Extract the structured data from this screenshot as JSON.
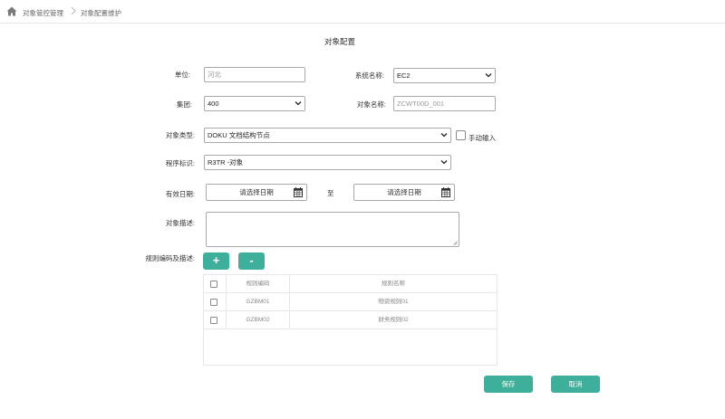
{
  "breadcrumb": {
    "home_icon": "home-icon",
    "item1": "对象管控管理",
    "item2": "对象配置维护"
  },
  "page": {
    "title": "对象配置"
  },
  "form": {
    "unit": {
      "label": "单位:",
      "value": "",
      "placeholder": "河北"
    },
    "system_name": {
      "label": "系统名称:",
      "value": "EC2"
    },
    "group": {
      "label": "集团:",
      "value": "400"
    },
    "object_name": {
      "label": "对象名称:",
      "value": "",
      "placeholder": "ZCWT00D_001"
    },
    "object_type": {
      "label": "对象类型:",
      "value": "DOKU 文档结构节点"
    },
    "manual_input": {
      "label": "手动输入",
      "checked": false
    },
    "program_id": {
      "label": "程序标识:",
      "value": "R3TR -对象"
    },
    "valid_date": {
      "label": "有效日期:",
      "start_placeholder": "请选择日期",
      "to_label": "至",
      "end_placeholder": "请选择日期"
    },
    "object_desc": {
      "label": "对象描述:",
      "value": ""
    },
    "rules": {
      "label": "规则编码及描述:",
      "add_symbol": "+",
      "remove_symbol": "-",
      "columns": [
        "规则编码",
        "规则名称"
      ],
      "rows": [
        {
          "code": "GZBM01",
          "name": "物资规则01"
        },
        {
          "code": "GZBM02",
          "name": "财务规则02"
        }
      ]
    }
  },
  "actions": {
    "save": "保存",
    "cancel": "取消"
  },
  "colors": {
    "accent": "#3daf9a",
    "border": "#a9a9a9",
    "grid_line": "#e7e7e7"
  }
}
